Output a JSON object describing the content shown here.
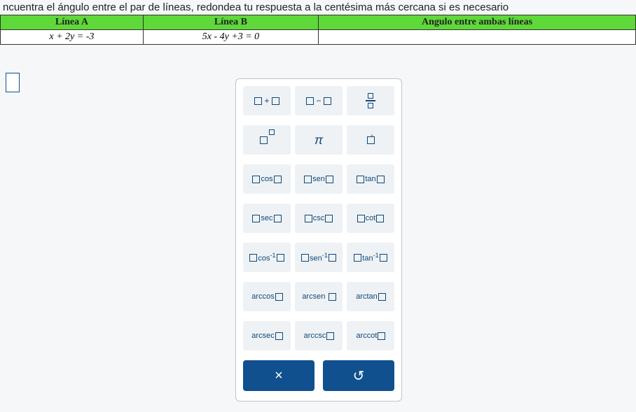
{
  "question_text": "ncuentra el ángulo entre el par de líneas, redondea tu respuesta a la centésima más cercana si es necesario",
  "table": {
    "headers": [
      "Línea A",
      "Línea B",
      "Angulo entre ambas líneas"
    ],
    "row": [
      "x + 2y = -3",
      "5x - 4y +3 = 0",
      ""
    ]
  },
  "keypad": {
    "pi": "π",
    "cos": "cos",
    "sen": "sen",
    "tan": "tan",
    "sec": "sec",
    "csc": "csc",
    "cot": "cot",
    "cos_inv": "cos",
    "sen_inv": "sen",
    "tan_inv": "tan",
    "arccos": "arccos",
    "arcsen": "arcsen",
    "arctan": "arctan",
    "arcsec": "arcsec",
    "arccsc": "arccsc",
    "arccot": "arccot"
  },
  "buttons": {
    "close": "×",
    "reset": "↺"
  }
}
